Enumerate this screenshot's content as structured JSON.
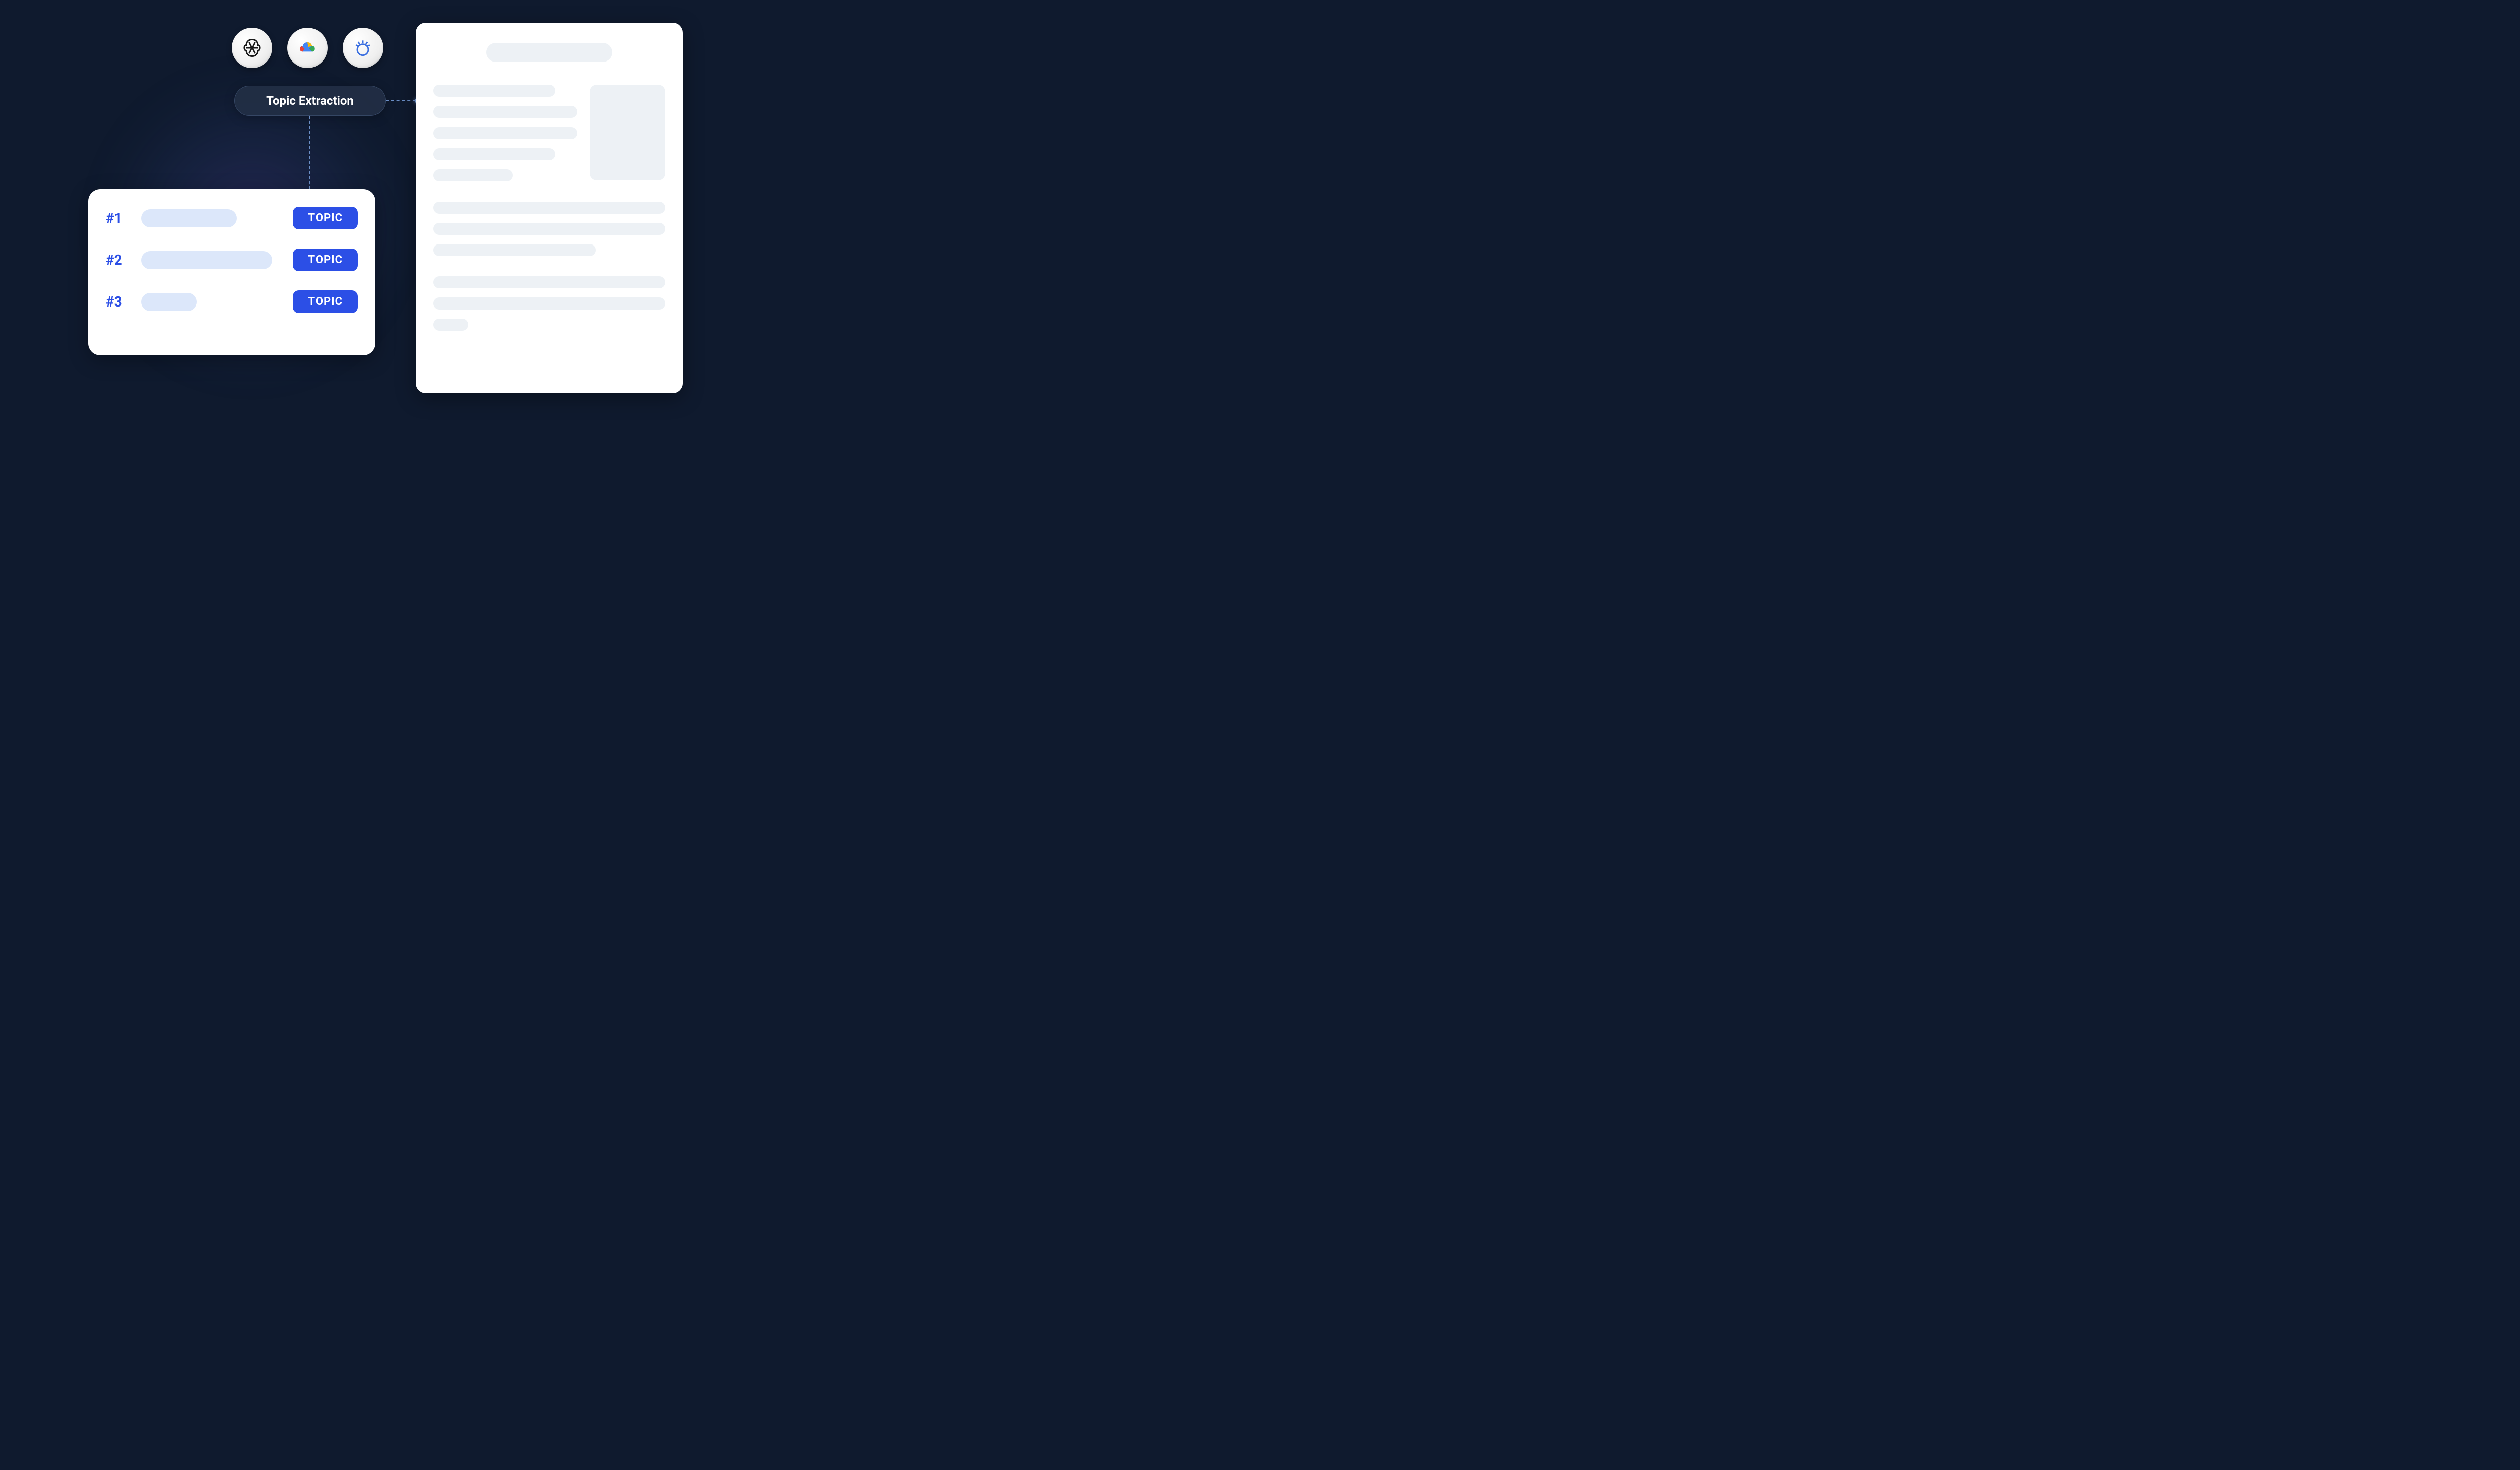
{
  "pill_label": "Topic Extraction",
  "providers": [
    {
      "name": "openai"
    },
    {
      "name": "google-cloud"
    },
    {
      "name": "ibm-watson"
    }
  ],
  "topics": [
    {
      "number": "#1",
      "tag": "TOPIC"
    },
    {
      "number": "#2",
      "tag": "TOPIC"
    },
    {
      "number": "#3",
      "tag": "TOPIC"
    }
  ],
  "colors": {
    "accent": "#2c4fe6",
    "background": "#0f1a2e",
    "light_bar": "#dce7fa",
    "doc_placeholder": "#edf1f5"
  }
}
